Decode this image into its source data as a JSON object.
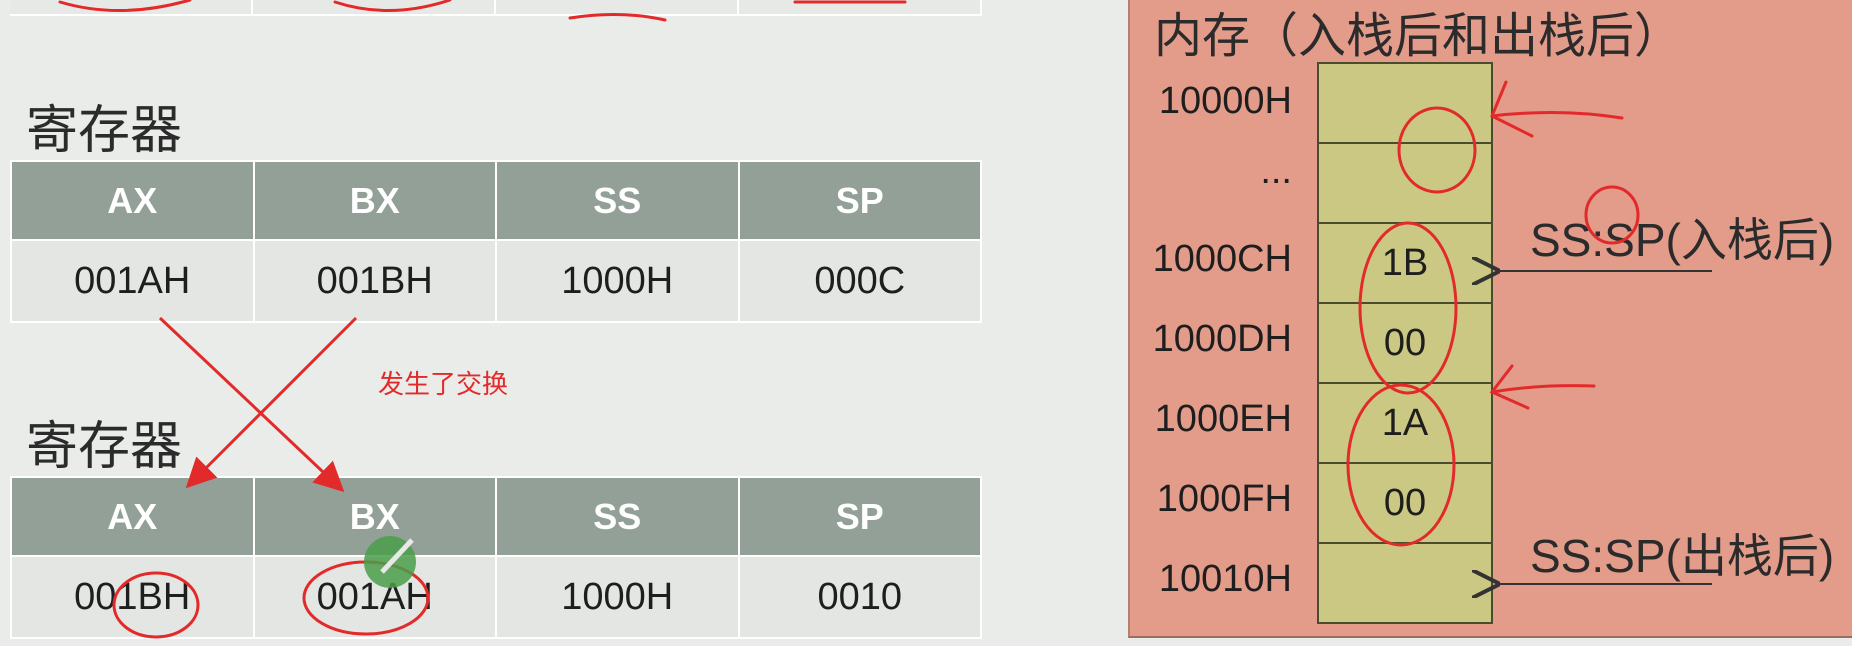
{
  "registers_title": "寄存器",
  "table_headers": [
    "AX",
    "BX",
    "SS",
    "SP"
  ],
  "table1_values": [
    "001AH",
    "001BH",
    "1000H",
    "000C"
  ],
  "table2_values": [
    "001BH",
    "001AH",
    "1000H",
    "0010"
  ],
  "swap_note": "发生了交换",
  "memory": {
    "title": "内存（入栈后和出栈后）",
    "addresses": [
      "10000H",
      "...",
      "1000CH",
      "1000DH",
      "1000EH",
      "1000FH",
      "10010H"
    ],
    "cells": [
      "",
      "",
      "1B",
      "00",
      "1A",
      "00",
      ""
    ],
    "ptr_push": "SS:SP(入栈后)",
    "ptr_pop": "SS:SP(出栈后)"
  },
  "colors": {
    "header_bg": "#92a097",
    "memory_panel_bg": "#e39b8a",
    "memory_cell_bg": "#cbc883",
    "annotation_red": "#e32a2a"
  }
}
